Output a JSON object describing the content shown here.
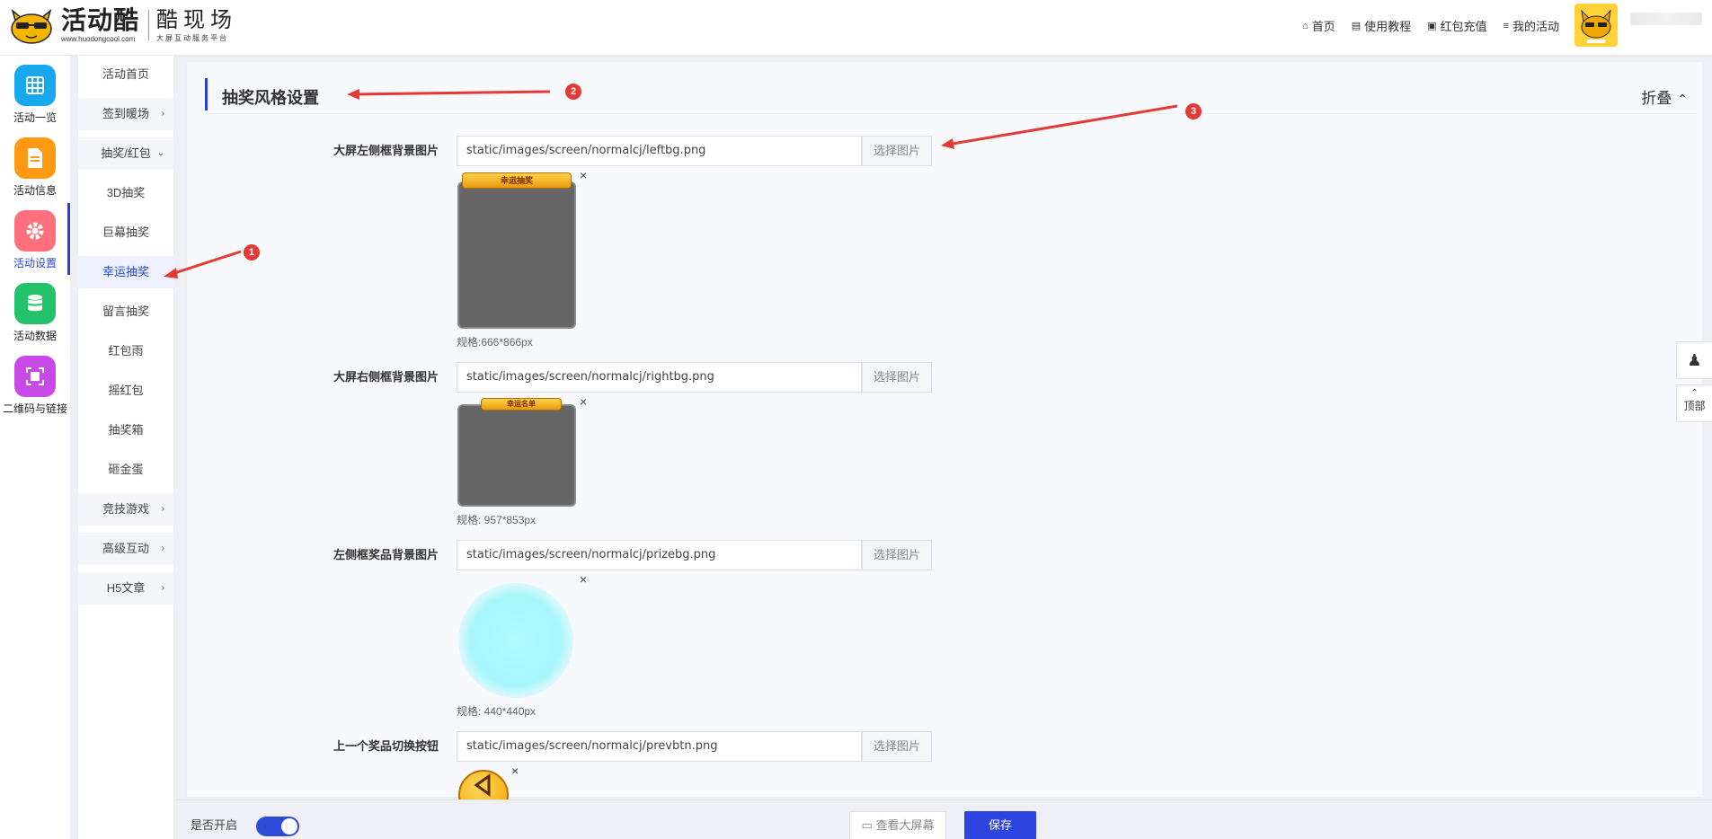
{
  "header": {
    "logo_main": "活动酷",
    "logo_url": "www.huodongcool.com",
    "logo_sub_main": "酷现场",
    "logo_sub": "大屏互动服务平台",
    "nav": [
      {
        "icon": "home-icon",
        "glyph": "⌂",
        "label": "首页"
      },
      {
        "icon": "book-icon",
        "glyph": "▤",
        "label": "使用教程"
      },
      {
        "icon": "wallet-icon",
        "glyph": "▣",
        "label": "红包充值"
      },
      {
        "icon": "list-icon",
        "glyph": "≡",
        "label": "我的活动"
      }
    ]
  },
  "rail": [
    {
      "label": "活动一览",
      "icon": "grid-icon",
      "color": "#17a8ee"
    },
    {
      "label": "活动信息",
      "icon": "document-icon",
      "color": "#ff9a12"
    },
    {
      "label": "活动设置",
      "icon": "gear-icon",
      "color": "#ff6f7d"
    },
    {
      "label": "活动数据",
      "icon": "database-icon",
      "color": "#23c26b"
    },
    {
      "label": "二维码与链接",
      "icon": "qrcode-icon",
      "color": "#c74ae6"
    }
  ],
  "subnav": [
    {
      "label": "活动首页"
    },
    {
      "label": "签到暖场"
    },
    {
      "label": "抽奖/红包"
    },
    {
      "label": "3D抽奖"
    },
    {
      "label": "巨幕抽奖"
    },
    {
      "label": "幸运抽奖"
    },
    {
      "label": "留言抽奖"
    },
    {
      "label": "红包雨"
    },
    {
      "label": "摇红包"
    },
    {
      "label": "抽奖箱"
    },
    {
      "label": "砸金蛋"
    },
    {
      "label": "竞技游戏"
    },
    {
      "label": "高级互动"
    },
    {
      "label": "H5文章"
    }
  ],
  "section": {
    "title": "抽奖风格设置",
    "fold_label": "折叠"
  },
  "fields": [
    {
      "label": "大屏左侧框背景图片",
      "value": "static/images/screen/normalcj/leftbg.png",
      "button": "选择图片",
      "spec": "规格:666*866px",
      "ribbon": "幸运抽奖"
    },
    {
      "label": "大屏右侧框背景图片",
      "value": "static/images/screen/normalcj/rightbg.png",
      "button": "选择图片",
      "spec": "规格: 957*853px",
      "ribbon": "幸运名单"
    },
    {
      "label": "左侧框奖品背景图片",
      "value": "static/images/screen/normalcj/prizebg.png",
      "button": "选择图片",
      "spec": "规格: 440*440px"
    },
    {
      "label": "上一个奖品切换按钮",
      "value": "static/images/screen/normalcj/prevbtn.png",
      "button": "选择图片"
    }
  ],
  "close_glyph": "×",
  "annotations": [
    "1",
    "2",
    "3"
  ],
  "float": {
    "qq_glyph": "♟",
    "top_glyph": "⌃",
    "top_label": "顶部"
  },
  "footer": {
    "enable_label": "是否开启",
    "enabled": true,
    "view_label": "查看大屏幕",
    "view_glyph": "▭",
    "save_label": "保存"
  }
}
